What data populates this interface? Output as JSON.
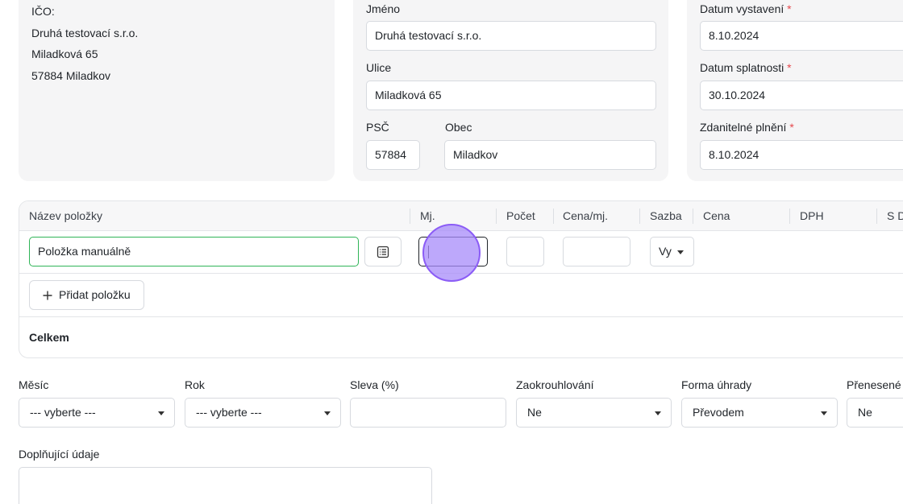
{
  "supplier": {
    "ico_label": "IČO:",
    "name": "Druhá testovací s.r.o.",
    "street": "Miladková 65",
    "city_line": "57884 Miladkov"
  },
  "customer": {
    "name_label": "Jméno",
    "name_value": "Druhá testovací s.r.o.",
    "street_label": "Ulice",
    "street_value": "Miladková 65",
    "zip_label": "PSČ",
    "zip_value": "57884",
    "city_label": "Obec",
    "city_value": "Miladkov"
  },
  "dates": {
    "issue_label": "Datum vystavení",
    "issue_value": "8.10.2024",
    "due_label": "Datum splatnosti",
    "due_value": "30.10.2024",
    "taxable_label": "Zdanitelné plnění",
    "taxable_value": "8.10.2024",
    "required_mark": "*"
  },
  "items": {
    "columns": [
      "Název položky",
      "Mj.",
      "Počet",
      "Cena/mj.",
      "Sazba",
      "Cena",
      "DPH",
      "S D"
    ],
    "row": {
      "name_value": "Položka manuálně",
      "unit_value": "",
      "count_value": "",
      "price_value": "",
      "rate_value": "Vy"
    },
    "add_button": "Přidat položku",
    "total_label": "Celkem"
  },
  "options": {
    "month_label": "Měsíc",
    "month_value": "--- vyberte ---",
    "year_label": "Rok",
    "year_value": "--- vyberte ---",
    "discount_label": "Sleva (%)",
    "discount_value": "",
    "rounding_label": "Zaokrouhlování",
    "rounding_value": "Ne",
    "payment_label": "Forma úhrady",
    "payment_value": "Převodem",
    "transferred_label": "Přenesené",
    "transferred_value": "Ne"
  },
  "extra": {
    "label": "Doplňující údaje",
    "value": ""
  },
  "colors": {
    "card_bg": "#f5f5f6",
    "focus_green": "#2fb457",
    "cursor_purple": "#a78bfa",
    "required_red": "#e5484d"
  }
}
